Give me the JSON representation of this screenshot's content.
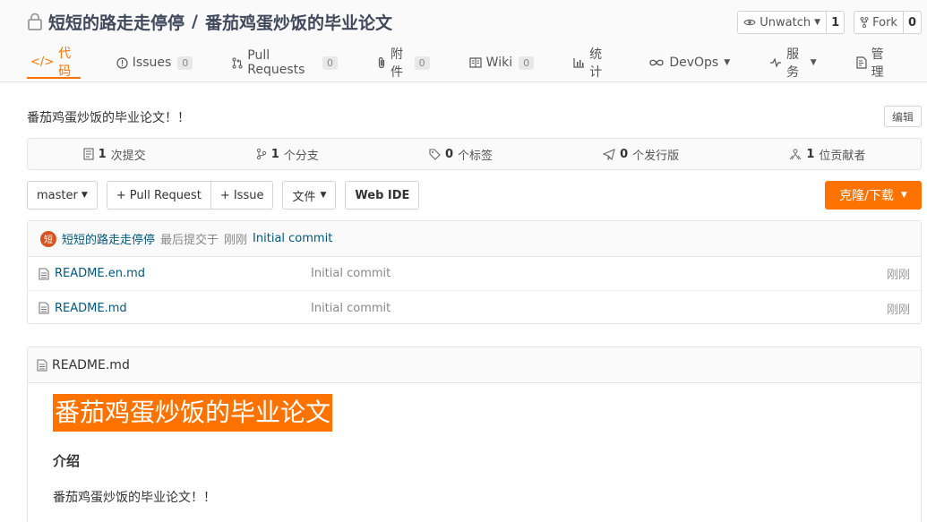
{
  "repo": {
    "owner": "短短的路走走停停",
    "separator": "/",
    "name": "番茄鸡蛋炒饭的毕业论文"
  },
  "actions": {
    "watch_label": "Unwatch",
    "watch_count": "1",
    "fork_label": "Fork",
    "fork_count": "0"
  },
  "tabs": [
    {
      "label": "代码"
    },
    {
      "label": "Issues",
      "badge": "0"
    },
    {
      "label": "Pull Requests",
      "badge": "0"
    },
    {
      "label": "附件",
      "badge": "0"
    },
    {
      "label": "Wiki",
      "badge": "0"
    },
    {
      "label": "统计"
    },
    {
      "label": "DevOps"
    },
    {
      "label": "服务"
    },
    {
      "label": "管理"
    }
  ],
  "description": "番茄鸡蛋炒饭的毕业论文！！",
  "edit_label": "编辑",
  "stats": [
    {
      "num": "1",
      "label": "次提交"
    },
    {
      "num": "1",
      "label": "个分支"
    },
    {
      "num": "0",
      "label": "个标签"
    },
    {
      "num": "0",
      "label": "个发行版"
    },
    {
      "num": "1",
      "label": "位贡献者"
    }
  ],
  "toolbar": {
    "branch": "master",
    "pull_request": "+ Pull Request",
    "issue": "+ Issue",
    "file": "文件",
    "web_ide": "Web IDE",
    "clone": "克隆/下载"
  },
  "commit": {
    "avatar_char": "短",
    "author": "短短的路走走停停",
    "meta": "最后提交于",
    "time": "刚刚",
    "message": "Initial commit"
  },
  "files": [
    {
      "name": "README.en.md",
      "commit": "Initial commit",
      "time": "刚刚"
    },
    {
      "name": "README.md",
      "commit": "Initial commit",
      "time": "刚刚"
    }
  ],
  "readme": {
    "filename": "README.md",
    "h1": "番茄鸡蛋炒饭的毕业论文",
    "h3": "介绍",
    "p": "番茄鸡蛋炒饭的毕业论文！！"
  },
  "colors": {
    "accent": "#fe7300",
    "link": "#005980"
  }
}
